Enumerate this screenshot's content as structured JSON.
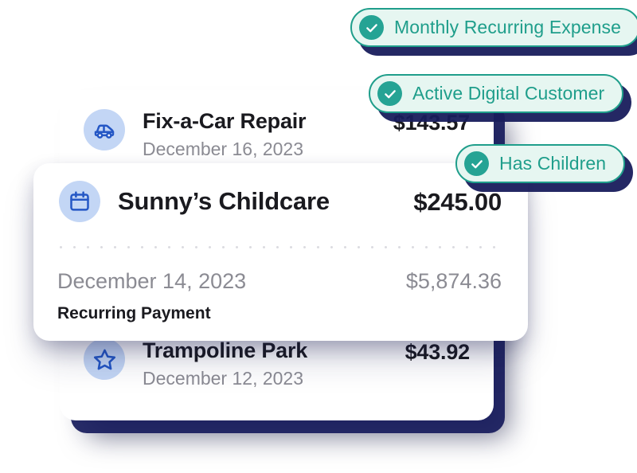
{
  "pills": [
    {
      "id": "monthly-recurring-expense",
      "label": "Monthly Recurring Expense",
      "icon": "check-circle-icon"
    },
    {
      "id": "active-digital-customer",
      "label": "Active Digital Customer",
      "icon": "check-circle-icon"
    },
    {
      "id": "has-children",
      "label": "Has Children",
      "icon": "check-circle-icon"
    }
  ],
  "back_card": {
    "rows": [
      {
        "id": "fix-a-car-repair",
        "icon": "car-icon",
        "merchant": "Fix-a-Car Repair",
        "date": "December 16, 2023",
        "amount": "$143.57"
      },
      {
        "id": "trampoline-park",
        "icon": "star-icon",
        "merchant": "Trampoline Park",
        "date": "December 12, 2023",
        "amount": "$43.92"
      }
    ]
  },
  "front_card": {
    "header": {
      "icon": "calendar-icon",
      "merchant": "Sunny’s Childcare",
      "amount": "$245.00"
    },
    "detail": {
      "date": "December 14, 2023",
      "balance": "$5,874.36",
      "label": "Recurring Payment"
    }
  },
  "colors": {
    "pill_accent": "#1f9e8b",
    "pill_check_fill": "#25a394",
    "pill_background": "#e6f6f1",
    "icon_badge_background": "#c3d6f5",
    "icon_stroke": "#2457c5",
    "card_background": "#ffffff",
    "shadow_navy": "#181c5c",
    "text_primary": "#1a1a1f",
    "text_muted": "#8b8b93"
  }
}
